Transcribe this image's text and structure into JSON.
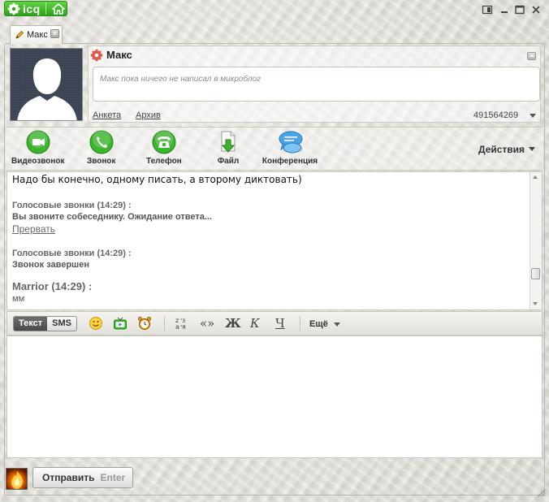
{
  "app": {
    "brand": "icq"
  },
  "tab": {
    "label": "Макс",
    "close": "×"
  },
  "contact": {
    "name": "Макс",
    "microblog_placeholder": "Макс пока ничего не написал в микроблог",
    "profile_link": "Анкета",
    "archive_link": "Архив",
    "uin": "491564269"
  },
  "actions": {
    "items": [
      {
        "label": "Видеозвонок",
        "icon": "video-call-icon"
      },
      {
        "label": "Звонок",
        "icon": "phone-handset-icon"
      },
      {
        "label": "Телефон",
        "icon": "telephone-icon"
      },
      {
        "label": "Файл",
        "icon": "file-icon"
      },
      {
        "label": "Конференция",
        "icon": "conference-icon"
      }
    ],
    "menu_label": "Действия"
  },
  "history": {
    "line1": "Надо бы конечно, одному писать, а второму диктовать)",
    "call1_head": "Голосовые звонки (14:29) :",
    "call1_body": "Вы звоните собеседнику. Ожидание ответа...",
    "call1_link": "Прервать",
    "call2_head": "Голосовые звонки (14:29) :",
    "call2_body": "Звонок завершен",
    "msg_author": "Marrior (14:29) :",
    "msg_text": "мм"
  },
  "compose": {
    "mode_text": "Текст",
    "mode_sms": "SMS",
    "format_translit": "«»",
    "bold": "Ж",
    "italic": "К",
    "underline": "Ч",
    "more_label": "Ещё",
    "send_label": "Отправить",
    "send_hint": "Enter"
  },
  "colors": {
    "accent_green": "#2ea21b",
    "send_bg": "#efefef"
  }
}
